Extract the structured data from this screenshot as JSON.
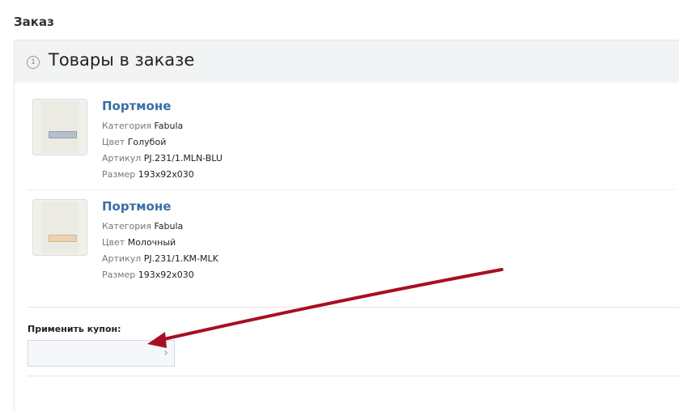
{
  "page": {
    "title": "Заказ"
  },
  "section": {
    "step": "1",
    "title": "Товары в заказе"
  },
  "labels": {
    "category": "Категория",
    "color": "Цвет",
    "article": "Артикул",
    "size": "Размер"
  },
  "products": [
    {
      "name": "Портмоне",
      "category": "Fabula",
      "color": "Голубой",
      "article": "PJ.231/1.MLN-BLU",
      "size": "193x92x030",
      "thumb_color": "#b4c0cc"
    },
    {
      "name": "Портмоне",
      "category": "Fabula",
      "color": "Молочный",
      "article": "PJ.231/1.KM-MLK",
      "size": "193x92x030",
      "thumb_color": "#ecd2b4"
    }
  ],
  "coupon": {
    "label": "Применить купон:",
    "value": "",
    "placeholder": ""
  },
  "colors": {
    "link": "#3a6ea5",
    "arrow": "#a80f23",
    "header_bg": "#f2f3f4"
  }
}
